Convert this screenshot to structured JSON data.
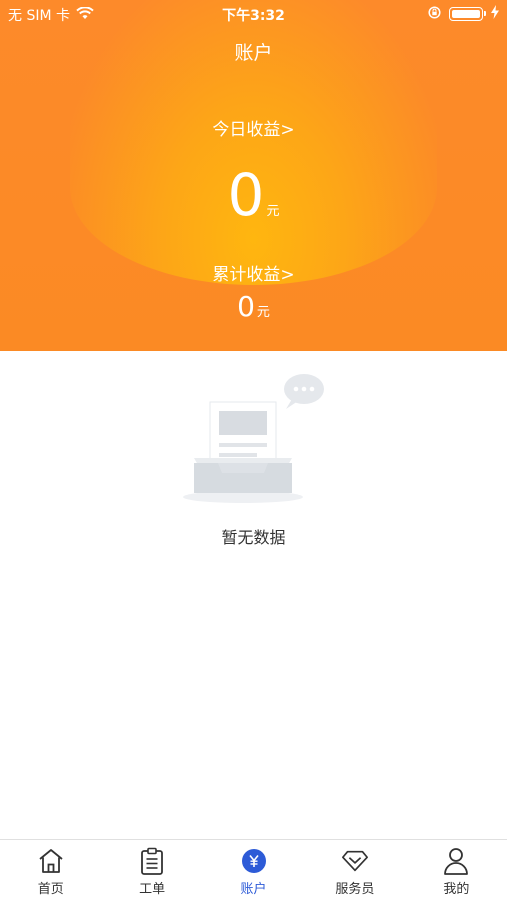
{
  "status_bar": {
    "carrier": "无 SIM 卡",
    "time": "下午3:32"
  },
  "header": {
    "title": "账户",
    "today_label": "今日收益>",
    "today_value": "0",
    "today_unit": "元",
    "total_label": "累计收益>",
    "total_value": "0",
    "total_unit": "元"
  },
  "empty_state": {
    "text": "暂无数据"
  },
  "tabbar": {
    "items": [
      {
        "label": "首页",
        "icon": "home-icon"
      },
      {
        "label": "工单",
        "icon": "clipboard-icon"
      },
      {
        "label": "账户",
        "icon": "yen-icon",
        "active": true
      },
      {
        "label": "服务员",
        "icon": "diamond-icon"
      },
      {
        "label": "我的",
        "icon": "person-icon"
      }
    ]
  },
  "colors": {
    "header_orange": "#fb8a24",
    "glow_yellow": "#ffb60f",
    "active_blue": "#2d5bd7"
  }
}
